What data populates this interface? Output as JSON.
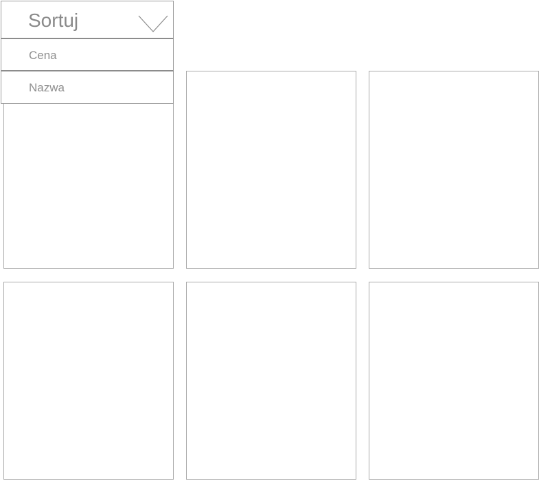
{
  "sort": {
    "label": "Sortuj",
    "icon": "chevron-down-icon",
    "options": [
      {
        "label": "Cena"
      },
      {
        "label": "Nazwa"
      }
    ]
  },
  "products": {
    "card_count": 6
  },
  "colors": {
    "border": "#a9a9a9",
    "text": "#8a8a8a",
    "background": "#ffffff"
  }
}
